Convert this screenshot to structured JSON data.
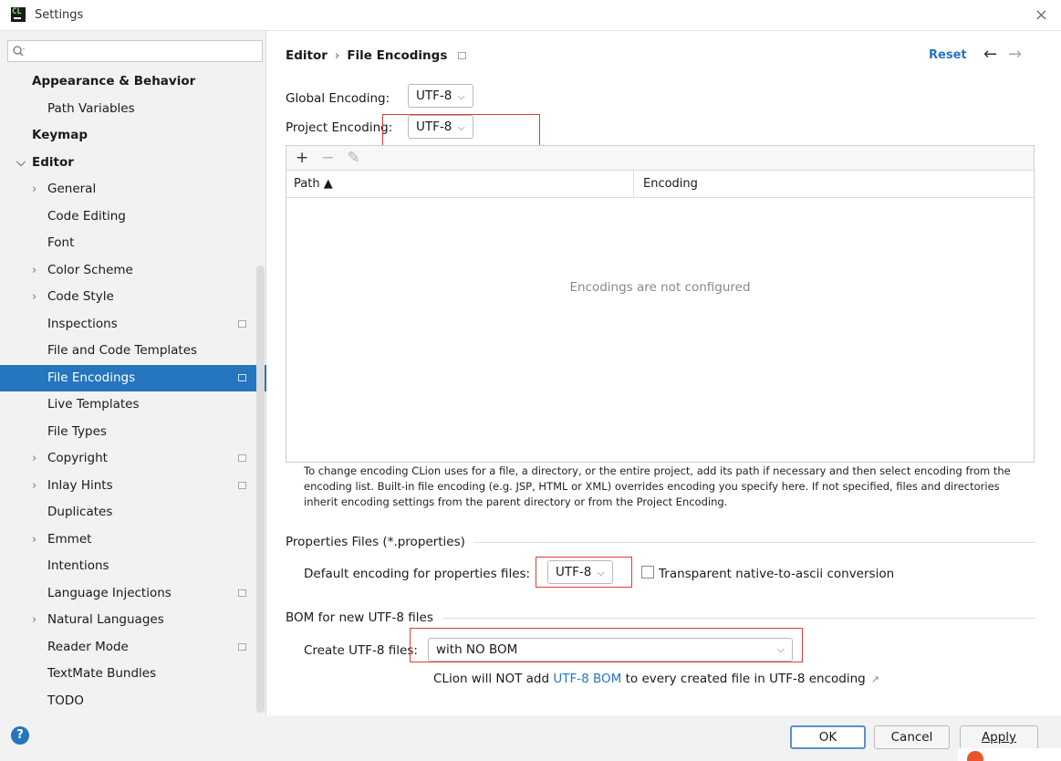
{
  "window": {
    "title": "Settings",
    "close": "×"
  },
  "search": {
    "placeholder": ""
  },
  "sidebar": {
    "items": [
      {
        "label": "Appearance & Behavior",
        "bold": true,
        "indent": 0,
        "arrow": ""
      },
      {
        "label": "Path Variables",
        "indent": 1,
        "arrow": ""
      },
      {
        "label": "Keymap",
        "bold": true,
        "indent": 0,
        "arrow": ""
      },
      {
        "label": "Editor",
        "bold": true,
        "indent": 0,
        "arrow": "expanded"
      },
      {
        "label": "General",
        "indent": 1,
        "arrow": "collapsed"
      },
      {
        "label": "Code Editing",
        "indent": 1,
        "arrow": ""
      },
      {
        "label": "Font",
        "indent": 1,
        "arrow": ""
      },
      {
        "label": "Color Scheme",
        "indent": 1,
        "arrow": "collapsed"
      },
      {
        "label": "Code Style",
        "indent": 1,
        "arrow": "collapsed"
      },
      {
        "label": "Inspections",
        "indent": 1,
        "arrow": "",
        "project": true
      },
      {
        "label": "File and Code Templates",
        "indent": 1,
        "arrow": ""
      },
      {
        "label": "File Encodings",
        "indent": 1,
        "arrow": "",
        "project": true,
        "selected": true
      },
      {
        "label": "Live Templates",
        "indent": 1,
        "arrow": ""
      },
      {
        "label": "File Types",
        "indent": 1,
        "arrow": ""
      },
      {
        "label": "Copyright",
        "indent": 1,
        "arrow": "collapsed",
        "project": true
      },
      {
        "label": "Inlay Hints",
        "indent": 1,
        "arrow": "collapsed",
        "project": true
      },
      {
        "label": "Duplicates",
        "indent": 1,
        "arrow": ""
      },
      {
        "label": "Emmet",
        "indent": 1,
        "arrow": "collapsed"
      },
      {
        "label": "Intentions",
        "indent": 1,
        "arrow": ""
      },
      {
        "label": "Language Injections",
        "indent": 1,
        "arrow": "",
        "project": true
      },
      {
        "label": "Natural Languages",
        "indent": 1,
        "arrow": "collapsed"
      },
      {
        "label": "Reader Mode",
        "indent": 1,
        "arrow": "",
        "project": true
      },
      {
        "label": "TextMate Bundles",
        "indent": 1,
        "arrow": ""
      },
      {
        "label": "TODO",
        "indent": 1,
        "arrow": ""
      }
    ]
  },
  "header": {
    "breadcrumb_parent": "Editor",
    "breadcrumb_sep": "›",
    "breadcrumb_current": "File Encodings",
    "reset": "Reset",
    "back": "←",
    "forward": "→"
  },
  "encoding": {
    "global_label": "Global Encoding:",
    "global_value": "UTF-8",
    "project_label": "Project Encoding:",
    "project_value": "UTF-8"
  },
  "table": {
    "toolbar": {
      "add": "+",
      "remove": "−",
      "edit": "✎"
    },
    "columns": [
      "Path ▲",
      "Encoding"
    ],
    "empty_text": "Encodings are not configured"
  },
  "help_text": "To change encoding CLion uses for a file, a directory, or the entire project, add its path if necessary and then select encoding from the encoding list. Built-in file encoding (e.g. JSP, HTML or XML) overrides encoding you specify here. If not specified, files and directories inherit encoding settings from the parent directory or from the Project Encoding.",
  "properties": {
    "group_title": "Properties Files (*.properties)",
    "default_label": "Default encoding for properties files:",
    "default_value": "UTF-8",
    "transparent_label": "Transparent native-to-ascii conversion",
    "transparent_checked": false
  },
  "bom": {
    "group_title": "BOM for new UTF-8 files",
    "create_label": "Create UTF-8 files:",
    "create_value": "with NO BOM",
    "info_prefix": "CLion will NOT add",
    "info_link": "UTF-8 BOM",
    "info_suffix": "to every created file in UTF-8 encoding",
    "info_ext": "↗"
  },
  "footer": {
    "help": "?",
    "ok": "OK",
    "cancel": "Cancel",
    "apply": "Apply"
  },
  "colors": {
    "accent": "#2675bf",
    "highlight": "#e03a3a"
  }
}
